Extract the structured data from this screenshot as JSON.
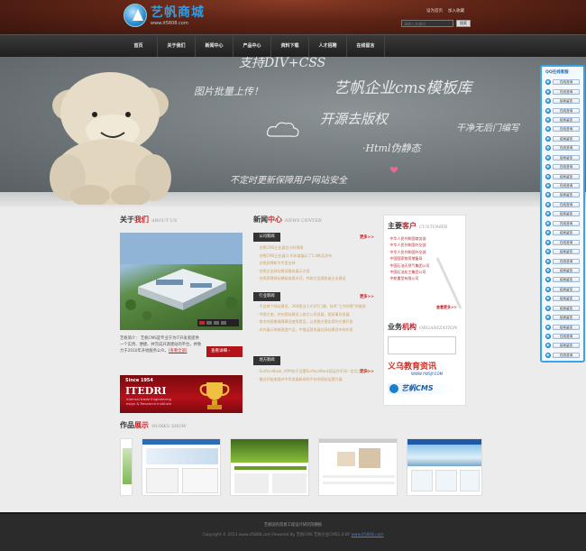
{
  "header": {
    "logo_text": "艺帆商城",
    "logo_url": "www.it5808.com",
    "top_links": [
      "设为首页",
      "加入收藏"
    ],
    "search_placeholder": "请输入关键词",
    "search_button": "搜索"
  },
  "nav": {
    "items": [
      "首页",
      "关于我们",
      "新闻中心",
      "产品中心",
      "资料下载",
      "人才招聘",
      "在线留言"
    ]
  },
  "banner": {
    "line1": "支持DIV+CSS",
    "line2": "图片批量上传！",
    "line3": "艺帆企业cms模板库",
    "line4": "开源去版权",
    "line5": "干净无后门编写",
    "line6": "·Html伪静态",
    "line7": "不定时更新保障用户网站安全"
  },
  "about": {
    "title_plain": "关于",
    "title_red": "我们",
    "title_en": "ABOUT US",
    "text": "艺帆简介：  艺帆CMS是专业于为IT开发者提供一个实用、便捷、并完成开源建站的平台，并致力于2010年开始服务公众，",
    "more_link": "[查看全部]",
    "detail_button": "查看详细",
    "badge_since": "Since 1954",
    "badge_name": "ITEDRI",
    "badge_sub": [
      "Internal trade Engineering",
      "esign & Research Institute"
    ]
  },
  "news": {
    "title_plain": "新闻",
    "title_red": "中心",
    "title_en": "NEWS CENTER",
    "more_label": "更多>>",
    "company_tab": "公司新闻",
    "company_items": [
      "艺帆CMS企业展会小时保障",
      "艺帆CMS企业展(1.0)年度展示了1.0新品发布",
      "艺帆获得新华专家支持",
      "艺帆企业网站建设服务展示方案",
      "艺帆获得网站模板商用许可，并助力全国各省企业建设"
    ],
    "industry_tab": "行业新闻",
    "industry_items": [
      "不会做个网站建设，260相当于大学5门课，技术“工作时期”的服务",
      "中国大使，并在网站建设上助力公司发展，相关事业发展",
      "首次的图像保障建设使用是否，让其更方便实用的方便开发",
      "对外展示系统改造产品，中推运营发展在网站建设中的作用"
    ],
    "local_tab": "地方新闻",
    "local_items": [
      "SurfaceBook_ARM处于设置SurfaceBook而运作不同一定设立领域",
      "最近开始加强对中华发展新闻的平台的网站运营开展"
    ]
  },
  "clients": {
    "title_plain": "主要",
    "title_red": "客户",
    "title_en": "CUSTOMER",
    "items": [
      "中华人民共和国商务部",
      "中华人民共和国外交部",
      "中华人民共和国外交部",
      "中国国家物资储备局",
      "中国石油天然气集团公司",
      "中国石油化工集团公司",
      "中航重型有限公司"
    ],
    "more_label": "查看更多>>"
  },
  "org": {
    "title_plain": "业务",
    "title_red": "机构",
    "title_en": "ORGANIZATION",
    "logo1_cn": "义乌教育资讯",
    "logo1_url": "WWW.YWSJY.COM",
    "logo2": "艺帆CMS"
  },
  "works": {
    "title_plain": "作品",
    "title_red": "展示",
    "title_en": "WORKS SHOW"
  },
  "qq": {
    "title": "QQ在线客服",
    "items": [
      "在线咨询",
      "在线咨询",
      "给我留言",
      "在线咨询",
      "给我留言",
      "在线咨询",
      "给我留言",
      "在线咨询",
      "给我留言",
      "在线咨询",
      "给我留言",
      "在线咨询",
      "给我留言",
      "在线咨询",
      "给我留言",
      "在线咨询",
      "给我留言",
      "在线咨询",
      "给我留言",
      "在线咨询",
      "给我留言",
      "给我留言",
      "给我留言",
      "给我留言",
      "给我留言",
      "给我留言",
      "给我留言",
      "在线咨询",
      "给我留言",
      "在线咨询"
    ]
  },
  "footer": {
    "line1": "艺帆国内贸易工程设计研究院模板",
    "line2": "Copyright © 2013 www.it5808.com Powered By 艺帆CMS 艺帆企业CMS1.0 BY",
    "link": "www.it5808.com"
  }
}
